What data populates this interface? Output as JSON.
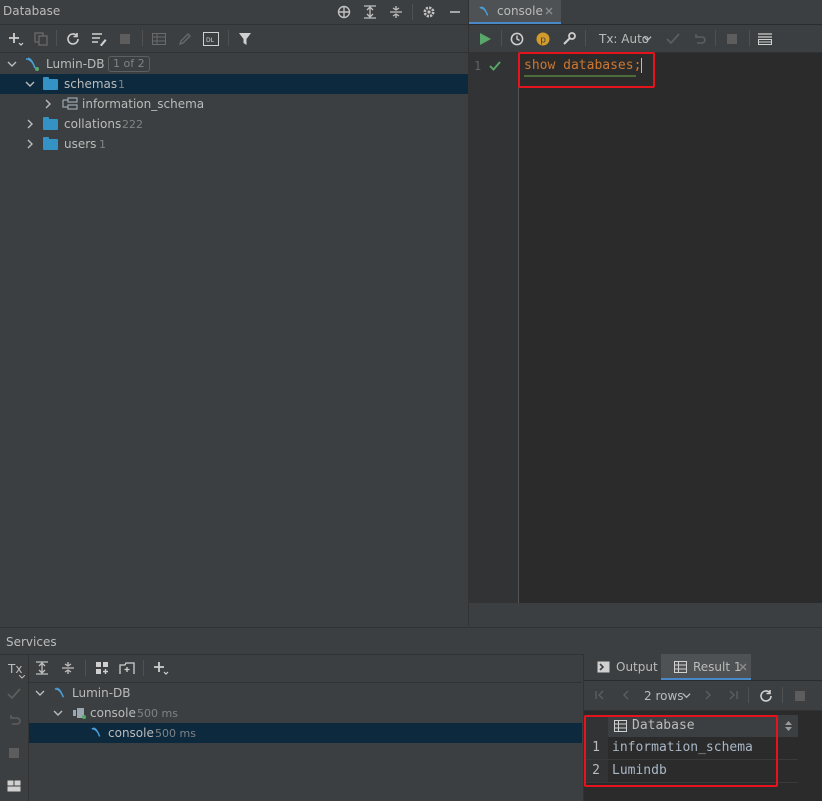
{
  "database_panel": {
    "title": "Database",
    "tree": {
      "root": {
        "label": "Lumin-DB",
        "badge": "1 of 2"
      },
      "schemas": {
        "label": "schemas",
        "count": "1"
      },
      "information_schema": {
        "label": "information_schema"
      },
      "collations": {
        "label": "collations",
        "count": "222"
      },
      "users": {
        "label": "users",
        "count": "1"
      }
    }
  },
  "editor": {
    "tab": {
      "label": "console"
    },
    "toolbar": {
      "tx_mode": "Tx: Auto"
    },
    "line_number": "1",
    "code": {
      "keyword1": "show",
      "keyword2": "databases",
      "semicolon": ";"
    },
    "colors": {
      "keyword": "#cc7832",
      "highlight": "#e5141c"
    }
  },
  "services": {
    "title": "Services",
    "left_toolbar": {
      "tx_label": "Tx"
    },
    "tree": {
      "root": {
        "label": "Lumin-DB"
      },
      "console_group": {
        "label": "console",
        "time": "500 ms"
      },
      "console_item": {
        "label": "console",
        "time": "500 ms"
      }
    },
    "result": {
      "tabs": [
        {
          "label": "Output"
        },
        {
          "label": "Result 1"
        }
      ],
      "rows_label": "2 rows",
      "column": "Database",
      "rows": [
        {
          "num": "1",
          "value": "information_schema"
        },
        {
          "num": "2",
          "value": "Lumindb"
        }
      ]
    }
  }
}
